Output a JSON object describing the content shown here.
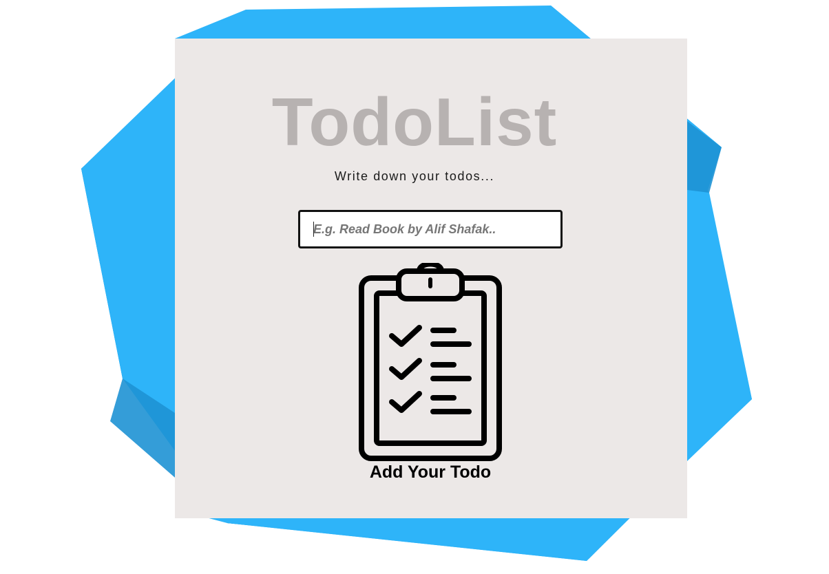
{
  "app": {
    "title": "TodoList",
    "subtitle": "Write down your todos..."
  },
  "todo_input": {
    "value": "",
    "placeholder": "E.g. Read Book by Alif Shafak.."
  },
  "add_button": {
    "label": "Add Your Todo",
    "icon": "clipboard-checklist-icon"
  },
  "colors": {
    "background_shape_light": "#2eb4f9",
    "background_shape_dark": "#1e92d4",
    "card_background": "#ece8e7",
    "title_color": "#b7b2b1"
  }
}
